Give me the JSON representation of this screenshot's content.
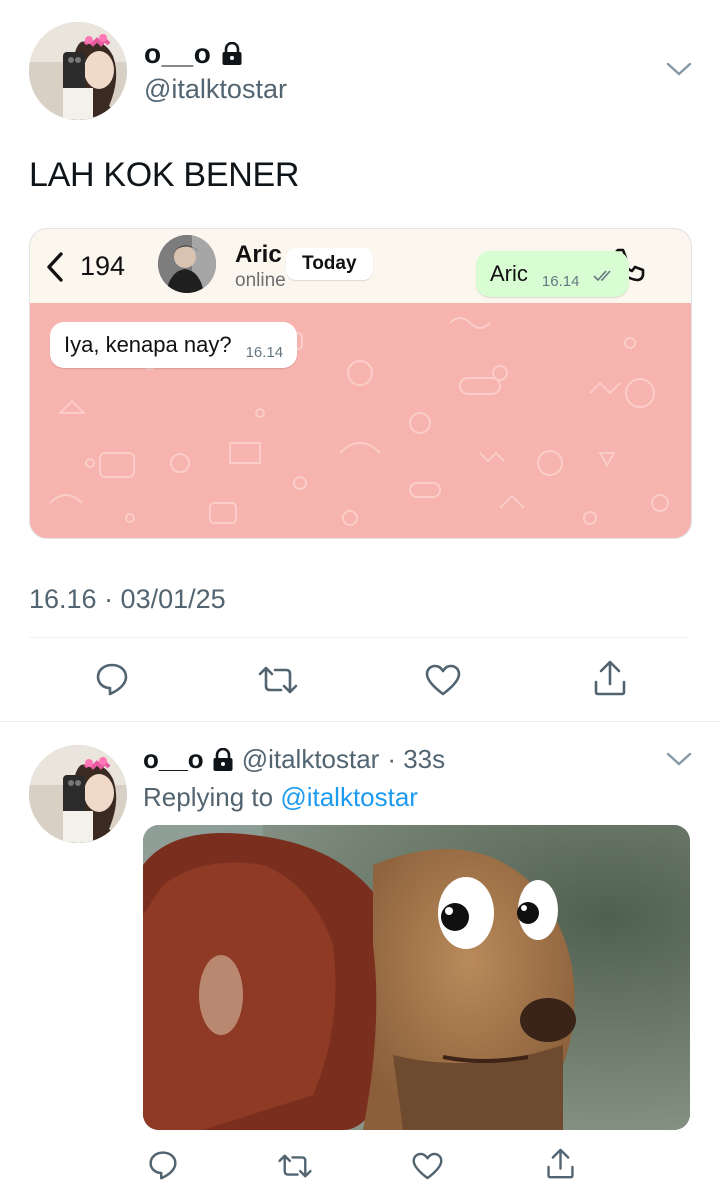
{
  "main_tweet": {
    "display_name": "o__o",
    "handle": "@italktostar",
    "text": "LAH KOK BENER",
    "timestamp": "16.16 · 03/01/25"
  },
  "chat_screenshot": {
    "back_count": "194",
    "contact_name": "Aric",
    "contact_status": "online",
    "day_label": "Today",
    "messages": [
      {
        "direction": "outgoing",
        "text": "Aric",
        "time": "16.14"
      },
      {
        "direction": "incoming",
        "text": "Iya, kenapa nay?",
        "time": "16.14"
      }
    ]
  },
  "reply_tweet": {
    "display_name": "o__o",
    "handle": "@italktostar",
    "age": "· 33s",
    "replying_prefix": "Replying to",
    "replying_to": "@italktostar"
  },
  "icons": {
    "lock": "lock-icon",
    "caret": "chevron-down-icon",
    "reply": "reply-icon",
    "retweet": "retweet-icon",
    "like": "heart-icon",
    "share": "share-icon",
    "video_call": "video-camera-icon",
    "voice_call": "phone-icon",
    "back": "chevron-left-icon"
  },
  "colors": {
    "text_primary": "#0f1419",
    "text_secondary": "#536471",
    "link": "#1d9bf0",
    "chat_background": "#f7b3ae",
    "outgoing_bubble": "#d9fdd3"
  }
}
